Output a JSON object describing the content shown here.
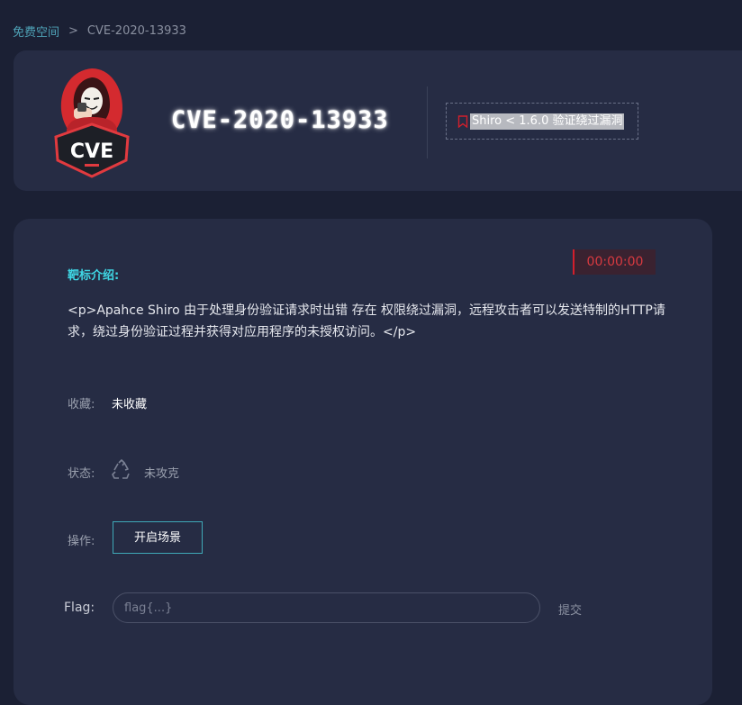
{
  "breadcrumb": {
    "parent": "免费空间",
    "separator": ">",
    "current": "CVE-2020-13933"
  },
  "header": {
    "logo_text": "CVE",
    "title": "CVE-2020-13933",
    "tag": "Shiro < 1.6.0 验证绕过漏洞"
  },
  "main": {
    "intro_label": "靶标介绍:",
    "timer": "00:00:00",
    "description": "<p>Apahce Shiro 由于处理身份验证请求时出错 存在 权限绕过漏洞，远程攻击者可以发送特制的HTTP请求，绕过身份验证过程并获得对应用程序的未授权访问。</p>",
    "favorite_label": "收藏:",
    "favorite_value": "未收藏",
    "status_label": "状态:",
    "status_value": "未攻克",
    "action_label": "操作:",
    "start_button": "开启场景",
    "flag_label": "Flag:",
    "flag_placeholder": "flag{...}",
    "flag_value": "",
    "submit": "提交"
  },
  "colors": {
    "accent": "#3fd6e4",
    "timer_red": "#d21f2c",
    "background": "#1b2034",
    "card": "#262c44"
  },
  "icons": {
    "bookmark": "bookmark-icon",
    "status": "recycle-icon",
    "breadcrumb_separator": "chevron-right-icon"
  }
}
